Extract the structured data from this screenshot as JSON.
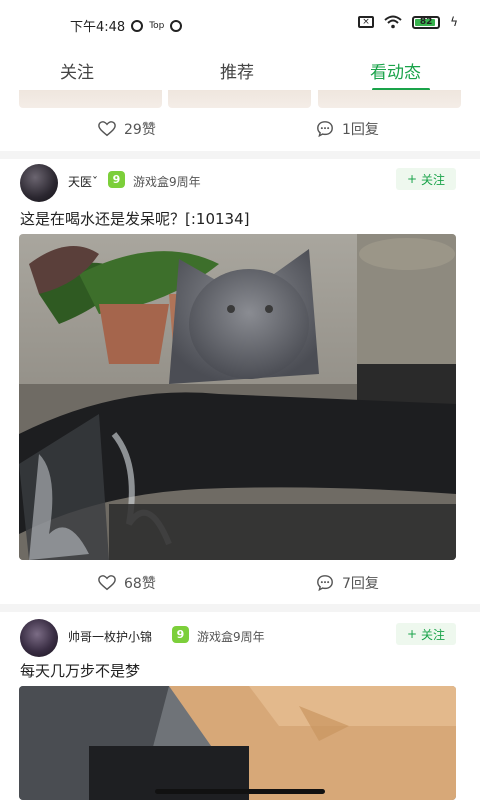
{
  "status_bar": {
    "time": "下午4:48",
    "carrier_mini": "Top",
    "battery_level": "82",
    "battery_fraction": 0.82
  },
  "tabs": [
    {
      "label": "关注",
      "active": false
    },
    {
      "label": "推荐",
      "active": false
    },
    {
      "label": "看动态",
      "active": true
    }
  ],
  "colors": {
    "accent": "#1aa34a",
    "follow_bg": "#eef8ee",
    "divider": "#f4f4f4"
  },
  "previous_post": {
    "likes": "29赞",
    "replies": "1回复"
  },
  "posts": [
    {
      "user_name": "天医ˇ",
      "badge": "9",
      "anniversary": "游戏盒9周年",
      "follow_label": "关注",
      "text": "这是在喝水还是发呆呢？[:10134]",
      "likes": "68赞",
      "replies": "7回复"
    },
    {
      "user_name": "帅哥一枚护小锦",
      "badge": "9",
      "anniversary": "游戏盒9周年",
      "follow_label": "关注",
      "text": "每天几万步不是梦"
    }
  ],
  "icons": {
    "like": "heart-icon",
    "reply": "comment-icon",
    "follow_plus": "plus-icon",
    "badge": "game-box-badge-icon"
  }
}
